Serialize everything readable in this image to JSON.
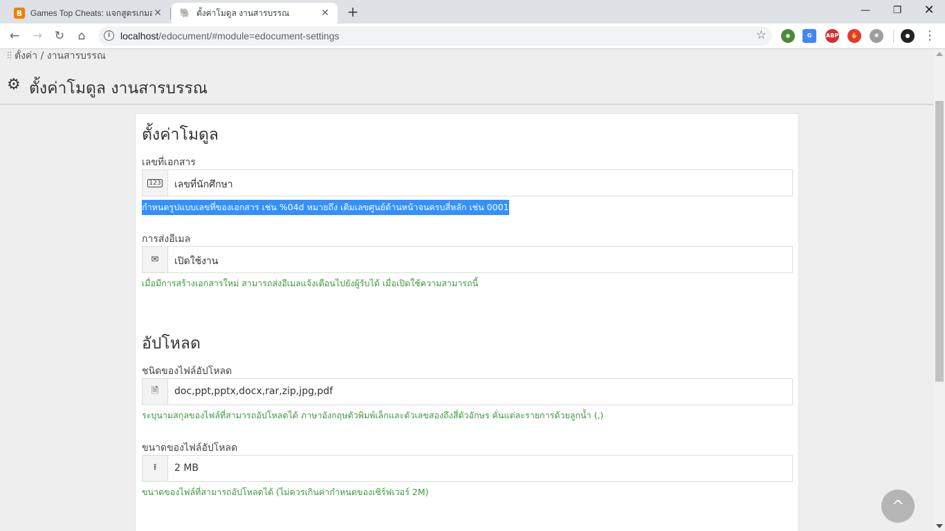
{
  "browser": {
    "tabs": [
      {
        "title": "Games Top Cheats: แจกสูตรเกมสาร์",
        "favicon": "blogger-icon",
        "active": false
      },
      {
        "title": "ตั้งค่าโมดูล งานสารบรรณ",
        "favicon": "elephant-icon",
        "active": true
      }
    ],
    "new_tab": "+",
    "url_host": "localhost",
    "url_path": "/edocument/#module=edocument-settings"
  },
  "breadcrumb": {
    "text": "ตั้งค่า / งานสารบรรณ"
  },
  "page_title": "ตั้งค่าโมดูล งานสารบรรณ",
  "sections": [
    {
      "title": "ตั้งค่าโมดูล",
      "fields": [
        {
          "label": "เลขที่เอกสาร",
          "icon": "number-icon",
          "value": "เลขที่นักศึกษา",
          "hint": "กำหนดรูปแบบเลขที่ของเอกสาร เช่น %04d หมายถึง เติมเลขศูนย์ด้านหน้าจนครบสี่หลัก เช่น 0001"
        },
        {
          "label": "การส่งอีเมล",
          "icon": "envelope-icon",
          "value": "เปิดใช้งาน",
          "hint": "เมื่อมีการสร้างเอกสารใหม่ สามารถส่งอีเมลแจ้งเตือนไปยังผู้รับได้ เมื่อเปิดใช้ความสามารถนี้"
        }
      ]
    },
    {
      "title": "อัปโหลด",
      "fields": [
        {
          "label": "ชนิดของไฟล์อัปโหลด",
          "icon": "file-icon",
          "value": "doc,ppt,pptx,docx,rar,zip,jpg,pdf",
          "hint": "ระบุนามสกุลของไฟล์ที่สามารถอัปโหลดได้ ภาษาอังกฤษตัวพิมพ์เล็กและตัวเลขสองถึงสี่ตัวอักษร คั่นแต่ละรายการด้วยลูกน้ำ (,)"
        },
        {
          "label": "ขนาดของไฟล์อัปโหลด",
          "icon": "upload-icon",
          "value": "2 MB",
          "hint": "ขนาดของไฟล์ที่สามารถอัปโหลดได้ (ไม่ควรเกินค่ากำหนดของเซิร์ฟเวอร์ 2M)"
        }
      ]
    }
  ],
  "colors": {
    "hint_green": "#3a9a3a",
    "selection_blue": "#3390ff"
  }
}
